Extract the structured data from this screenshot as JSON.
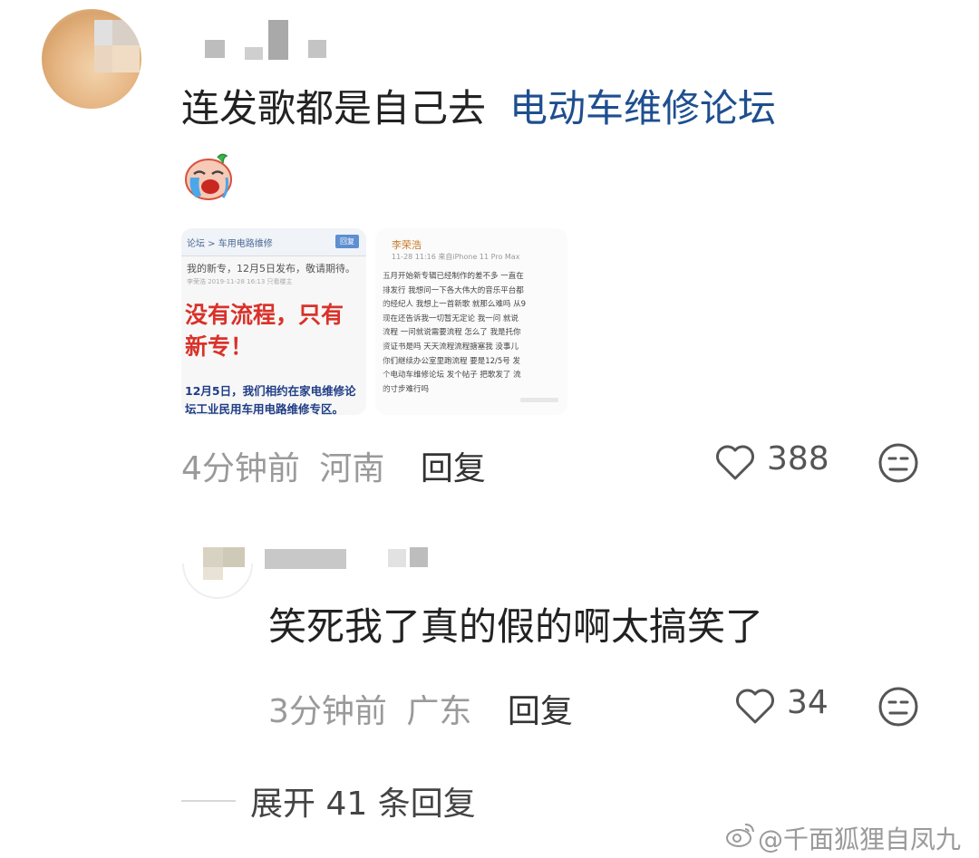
{
  "comment1": {
    "text": "连发歌都是自己去",
    "link_text": "电动车维修论坛",
    "time": "4分钟前",
    "location": "河南",
    "reply_label": "回复",
    "likes": "388"
  },
  "thumb1": {
    "breadcrumb": "论坛 > 车用电路维修",
    "button": "回复",
    "line1": "我的新专，12月5日发布，敬请期待。",
    "meta": "李荣浩 2019-11-28 16:13     只看楼主",
    "big_text": "没有流程，只有新专！",
    "blue_line1": "12月5日，我们相约在家电维修论",
    "blue_line2": "坛工业民用车用电路维修专区。"
  },
  "thumb2": {
    "name": "李荣浩",
    "meta": "11-28 11:16  来自iPhone 11 Pro Max",
    "lines": [
      "五月开始新专辑已经制作的差不多 一直在",
      "排发行 我想问一下各大伟大的音乐平台都",
      "的经纪人 我想上一首新歌 就那么难吗 从9",
      "现在还告诉我一切暂无定论 我一问 就说",
      "流程 一问就说需要流程 怎么了 我是托你",
      "资证书是吗 天天流程流程搪塞我  没事儿",
      "你们继续办公室里跑流程 要是12/5号 发",
      "个电动车维修论坛 发个帖子 把歌发了 流",
      "的寸步难行吗"
    ]
  },
  "comment2": {
    "text": "笑死我了真的假的啊太搞笑了",
    "time": "3分钟前",
    "location": "广东",
    "reply_label": "回复",
    "likes": "34"
  },
  "expand": {
    "label": "展开 41 条回复"
  },
  "watermark": {
    "text": "@千面狐狸自凤九"
  },
  "icons": {
    "like": "heart-outline-icon",
    "react": "neutral-face-icon",
    "weibo": "weibo-logo-icon"
  },
  "colors": {
    "link": "#1e4f8f",
    "meta_gray": "#9a9a9a",
    "thumb_red": "#d9322a",
    "thumb_blue": "#1f3d86"
  }
}
